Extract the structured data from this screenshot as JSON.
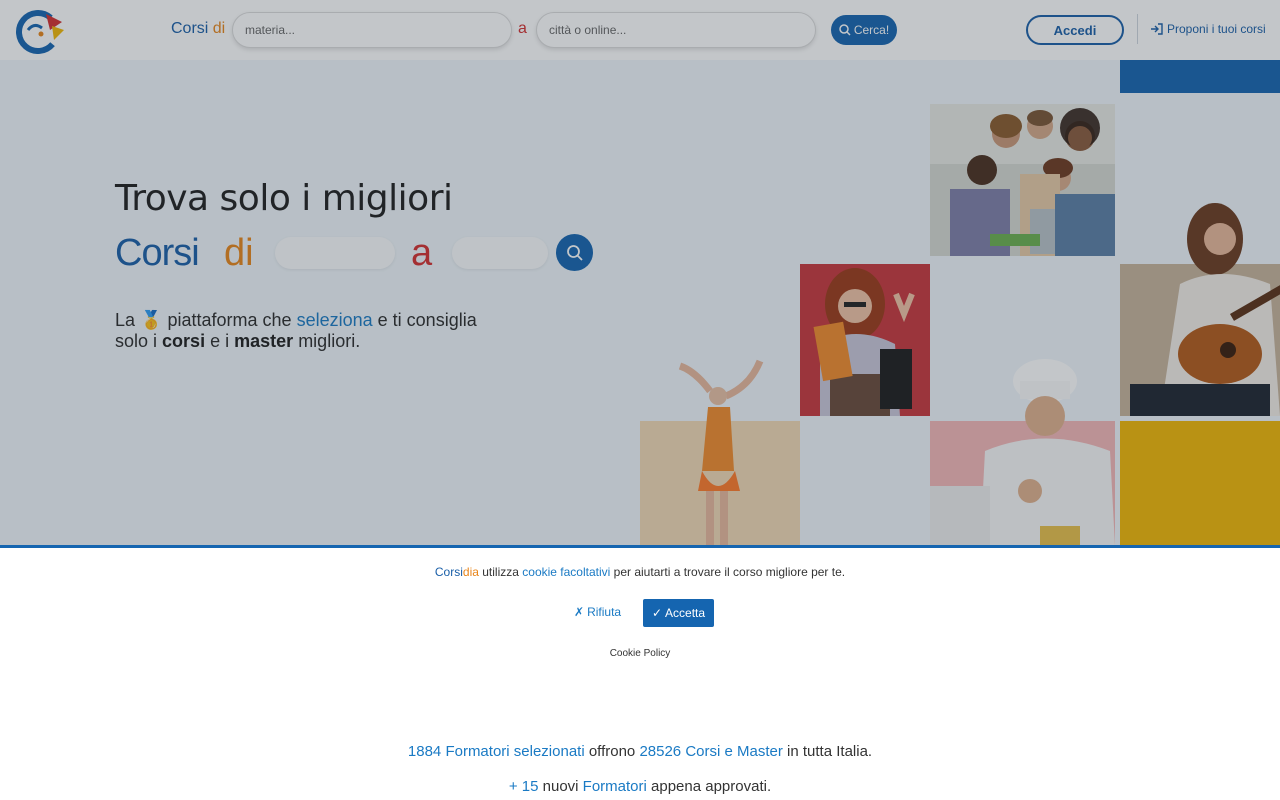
{
  "header": {
    "brand_prefix": "Corsi ",
    "brand_di": "di",
    "subject_placeholder": "materia...",
    "a_label": "a",
    "city_placeholder": "città o online...",
    "search_label": "Cerca!",
    "login_label": "Accedi",
    "propose_label": "Proponi i tuoi corsi"
  },
  "hero": {
    "title": "Trova solo i migliori",
    "brand_corsi": "Corsi",
    "brand_di": "di",
    "brand_a": "a",
    "tag_la": "La",
    "tag_medal": "🥇",
    "tag_mid": "piattaforma che",
    "tag_seleziona": "seleziona",
    "tag_rest1": "e ti consiglia",
    "tag_solo": "solo i",
    "tag_corsi": "corsi",
    "tag_e": "e i",
    "tag_master": "master",
    "tag_end": "migliori."
  },
  "cookie": {
    "brand_a": "Corsi",
    "brand_b": "dia",
    "text_1": " utilizza ",
    "link": "cookie facoltativi",
    "text_2": " per aiutarti a trovare il corso migliore per te.",
    "reject_label": "Rifiuta",
    "accept_label": "Accetta",
    "policy_label": "Cookie Policy"
  },
  "stats": {
    "trainers_count": "1884",
    "trainers_label": "Formatori selezionati",
    "offer_text": "offrono",
    "courses_count": "28526",
    "courses_label": "Corsi e Master",
    "suffix": "in tutta Italia.",
    "new_count": "+ 15",
    "new_text": "nuovi",
    "new_label": "Formatori",
    "new_suffix": "appena approvati."
  },
  "colors": {
    "primary": "#1565b0",
    "accent_orange": "#e8851a",
    "accent_red": "#d42f2f",
    "tile_red": "#c8373c",
    "tile_yellow": "#f2b705",
    "tile_pink": "#f4b8b8",
    "tile_beige": "#f1d9b5"
  }
}
